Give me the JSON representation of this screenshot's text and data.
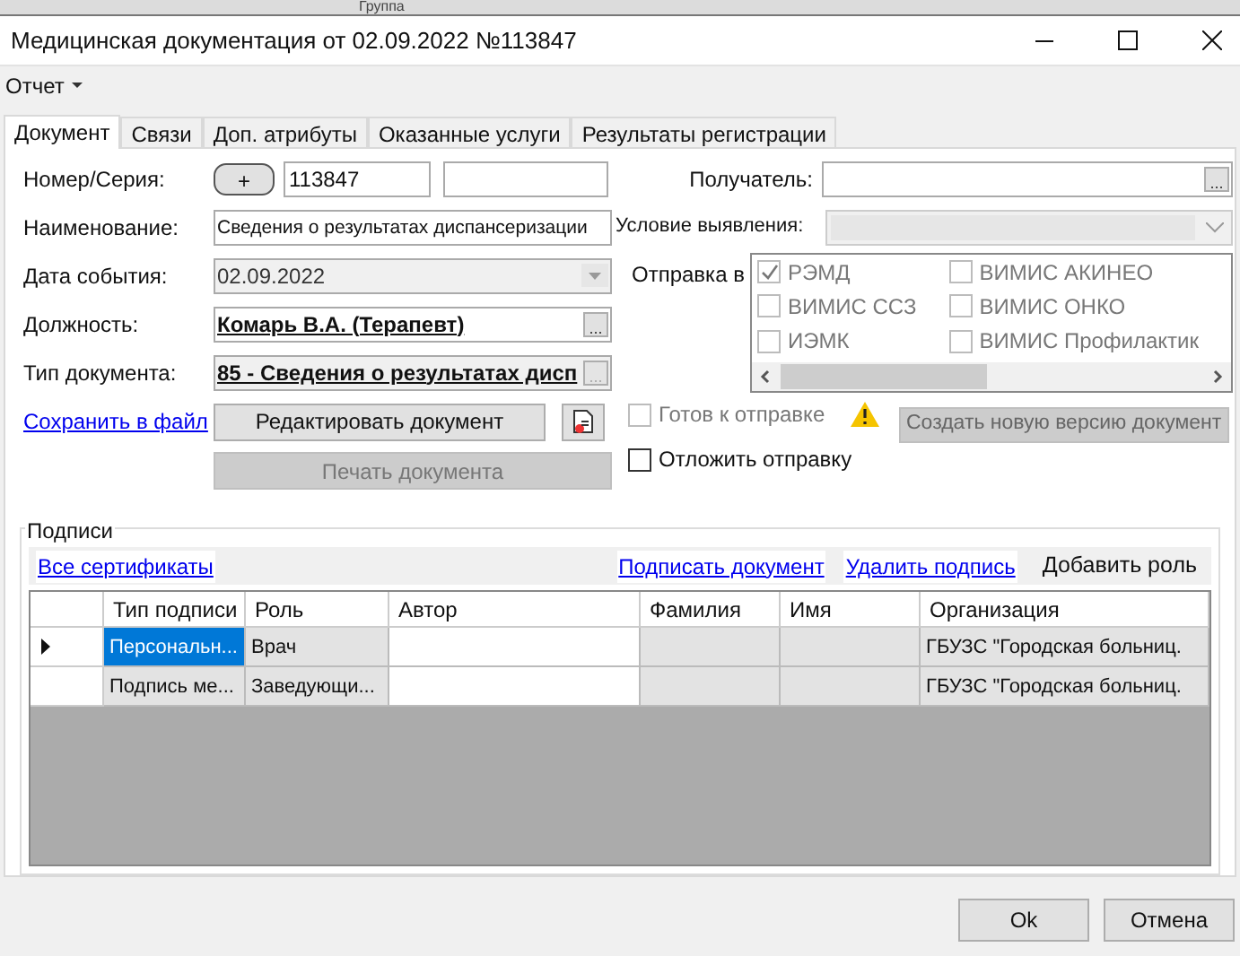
{
  "background_window": {
    "title": "Группа"
  },
  "window": {
    "title": "Медицинская документация от 02.09.2022 №113847"
  },
  "menu": [
    {
      "label": "Отчет"
    }
  ],
  "tabs": [
    {
      "label": "Документ",
      "selected": true
    },
    {
      "label": "Связи",
      "selected": false
    },
    {
      "label": "Доп. атрибуты",
      "selected": false
    },
    {
      "label": "Оказанные услуги",
      "selected": false
    },
    {
      "label": "Результаты регистрации",
      "selected": false
    }
  ],
  "fields": {
    "number": {
      "label": "Номер/Серия:",
      "button": "+",
      "value": "113847"
    },
    "name": {
      "label": "Наименование:",
      "value": "Сведения о результатах диспансеризации"
    },
    "event_date": {
      "label": "Дата события:",
      "value": "02.09.2022",
      "disabled": true
    },
    "position": {
      "label": "Должность:",
      "value": "Комарь В.А. (Терапевт)",
      "button": "...",
      "disabled": false
    },
    "doc_type": {
      "label": "Тип документа:",
      "value": "85 - Сведения о результатах дисп",
      "button": "...",
      "disabled": true
    },
    "recipient": {
      "label": "Получатель:",
      "button": "..."
    },
    "detection": {
      "label": "Условие выявления:",
      "disabled": true
    }
  },
  "save_link": "Сохранить в файл",
  "edit_button": {
    "label": "Редактировать документ",
    "disabled": false
  },
  "print_button": {
    "label": "Печать документа",
    "disabled": true
  },
  "send_to": {
    "label": "Отправка в",
    "options": [
      {
        "label": "РЭМД",
        "checked": true,
        "disabled": true
      },
      {
        "label": "ВИМИС ССЗ",
        "checked": false,
        "disabled": true
      },
      {
        "label": "ИЭМК",
        "checked": false,
        "disabled": true
      },
      {
        "label": "ВИМИС АКИНЕО",
        "checked": false,
        "disabled": true
      },
      {
        "label": "ВИМИС ОНКО",
        "checked": false,
        "disabled": true
      },
      {
        "label": "ВИМИС Профилактик",
        "checked": false,
        "disabled": true
      }
    ]
  },
  "ready": {
    "label": "Готов к отправке",
    "checked": false,
    "disabled": true
  },
  "postpone": {
    "label": "Отложить отправку",
    "checked": false,
    "disabled": false
  },
  "new_version_button": {
    "label": "Создать новую версию документ",
    "disabled": true
  },
  "signatures": {
    "title": "Подписи",
    "left_link": "Все сертификаты",
    "right_links": [
      "Подписать документ",
      "Удалить подпись"
    ],
    "add_role": "Добавить роль",
    "columns": [
      "Тип подписи",
      "Роль",
      "Автор",
      "Фамилия",
      "Имя",
      "Организация"
    ],
    "rows": [
      {
        "current": true,
        "selected": true,
        "type": "Персональн...",
        "role": "Врач",
        "organization": "ГБУЗС \"Городская больниц."
      },
      {
        "current": false,
        "selected": false,
        "type": "Подпись ме...",
        "role": "Заведующи...",
        "organization": "ГБУЗС \"Городская больниц."
      }
    ]
  },
  "footer_buttons": [
    {
      "label": "Ok"
    },
    {
      "label": "Отмена"
    }
  ]
}
